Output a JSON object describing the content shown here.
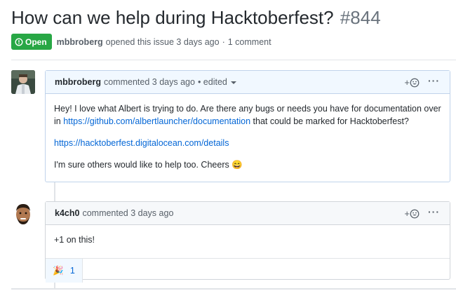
{
  "issue": {
    "title": "How can we help during Hacktoberfest?",
    "number": "#844",
    "state": "Open",
    "author": "mbbroberg",
    "opened_text": "opened this issue 3 days ago",
    "separator": "·",
    "comment_count": "1 comment",
    "colors": {
      "open_badge": "#28a745",
      "link": "#0366d6"
    }
  },
  "comments": [
    {
      "author": "mbbroberg",
      "action": "commented 3 days ago",
      "edited": "• edited",
      "add_reaction": "+",
      "more": "···",
      "body": {
        "p1_text": "Hey! I love what Albert is trying to do. Are there any bugs or needs you have for documentation over in",
        "p1_link": "https://github.com/albertlauncher/documentation",
        "p1_tail": "that could be marked for Hacktoberfest?",
        "p2_link": "https://hacktoberfest.digitalocean.com/details",
        "p3_text": "I'm sure others would like to help too. Cheers",
        "p3_emoji": "😄"
      }
    },
    {
      "author": "k4ch0",
      "action": "commented 3 days ago",
      "add_reaction": "+",
      "more": "···",
      "body": {
        "p1_text": "+1 on this!"
      },
      "reactions": [
        {
          "emoji": "🎉",
          "icon": "tada-icon",
          "count": "1"
        }
      ]
    }
  ]
}
